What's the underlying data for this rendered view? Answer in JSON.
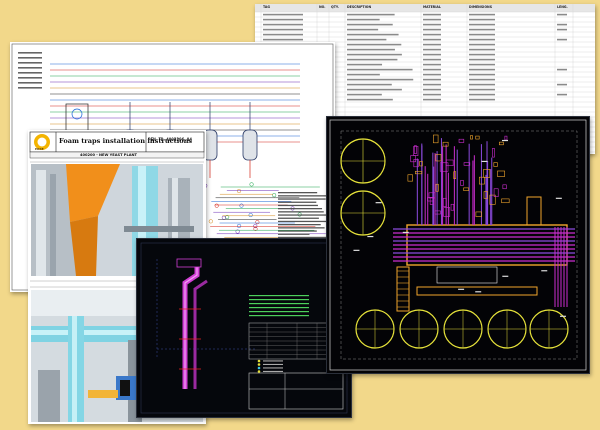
{
  "spreadsheet": {
    "columns": [
      "TAG",
      "NO.",
      "QTY.",
      "DESCRIPTION",
      "MATERIAL",
      "DIMENSIONS",
      "LENG."
    ],
    "header_accent": "#e6e6e6"
  },
  "instructions_doc": {
    "logo_text": "ERRE",
    "title": "Foam traps installation instructions",
    "doc_id": "PEN-TD-4003206.04",
    "subtitle": "400200 - NEW YEAST PLANT"
  },
  "colors": {
    "background": "#f2d88a",
    "cad_magenta": "#cc2dd0",
    "cad_yellow": "#e6e23a",
    "cad_orange": "#f1a62c",
    "pipe_cyan": "#6fd6ea",
    "pipe_orange": "#f49a18"
  }
}
